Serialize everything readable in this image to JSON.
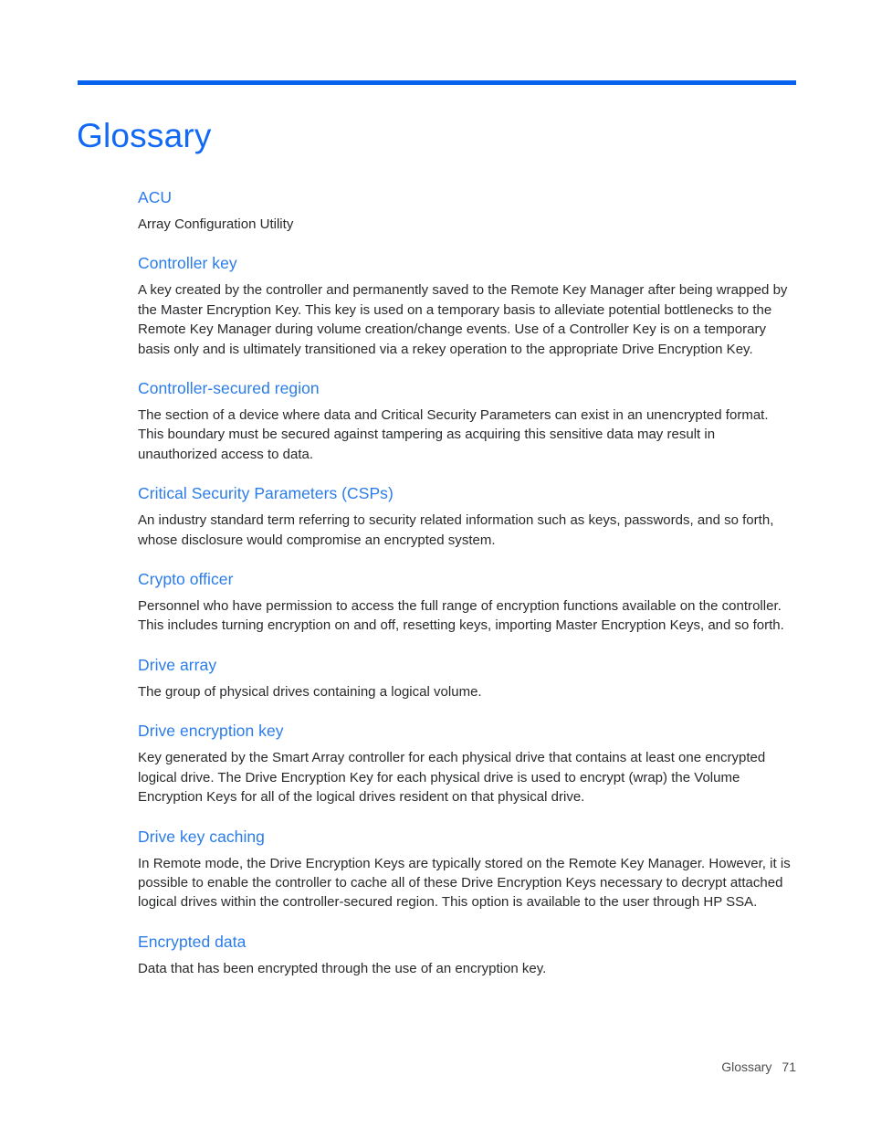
{
  "document": {
    "title": "Glossary",
    "accent_rule_color": "#0563f0",
    "title_color": "#1169f5",
    "term_color": "#2a7cea",
    "body_color": "#28292b"
  },
  "entries": [
    {
      "term": "ACU",
      "definition": "Array Configuration Utility"
    },
    {
      "term": "Controller key",
      "definition": "A key created by the controller and permanently saved to the Remote Key Manager after being wrapped by the Master Encryption Key. This key is used on a temporary basis to alleviate potential bottlenecks to the Remote Key Manager during volume creation/change events. Use of a Controller Key is on a temporary basis only and is ultimately transitioned via a rekey operation to the appropriate Drive Encryption Key."
    },
    {
      "term": "Controller-secured region",
      "definition": "The section of a device where data and Critical Security Parameters can exist in an unencrypted format. This boundary must be secured against tampering as acquiring this sensitive data may result in unauthorized access to data."
    },
    {
      "term": "Critical Security Parameters (CSPs)",
      "definition": "An industry standard term referring to security related information such as keys, passwords, and so forth, whose disclosure would compromise an encrypted system."
    },
    {
      "term": "Crypto officer",
      "definition": "Personnel who have permission to access the full range of encryption functions available on the controller. This includes turning encryption on and off, resetting keys, importing Master Encryption Keys, and so forth."
    },
    {
      "term": "Drive array",
      "definition": "The group of physical drives containing a logical volume."
    },
    {
      "term": "Drive encryption key",
      "definition": "Key generated by the Smart Array controller for each physical drive that contains at least one encrypted logical drive. The Drive Encryption Key for each physical drive is used to encrypt (wrap) the Volume Encryption Keys for all of the logical drives resident on that physical drive."
    },
    {
      "term": "Drive key caching",
      "definition": "In Remote mode, the Drive Encryption Keys are typically stored on the Remote Key Manager. However, it is possible to enable the controller to cache all of these Drive Encryption Keys necessary to decrypt attached logical drives within the controller-secured region. This option is available to the user through HP SSA."
    },
    {
      "term": "Encrypted data",
      "definition": "Data that has been encrypted through the use of an encryption key."
    }
  ],
  "footer": {
    "section_label": "Glossary",
    "page_number": "71"
  }
}
